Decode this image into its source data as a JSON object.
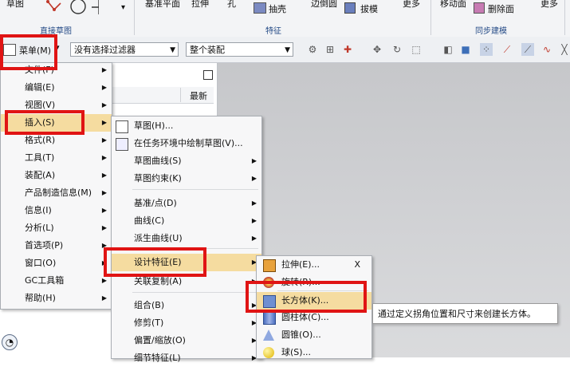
{
  "ribbon": {
    "sketch": "草图",
    "direct_sketch_group": "直接草图",
    "datum_plane": "基准平面",
    "extrude": "拉伸",
    "hole": "孔",
    "shell": "抽壳",
    "edge_blend": "边倒圆",
    "draft": "拔模",
    "more1": "更多",
    "feature_group": "特征",
    "move_face": "移动面",
    "delete_face": "删除面",
    "more2": "更多",
    "sync_group": "同步建模"
  },
  "cmdbar": {
    "menu_label": "菜单(M)",
    "filter": "没有选择过滤器",
    "assembly": "整个装配"
  },
  "panel": {
    "column_latest": "最新"
  },
  "main_menu": [
    {
      "label": "文件(F)",
      "sub": true
    },
    {
      "label": "编辑(E)",
      "sub": true
    },
    {
      "label": "视图(V)",
      "sub": true
    },
    {
      "label": "插入(S)",
      "sub": true
    },
    {
      "label": "格式(R)",
      "sub": true
    },
    {
      "label": "工具(T)",
      "sub": true
    },
    {
      "label": "装配(A)",
      "sub": true
    },
    {
      "label": "产品制造信息(M)",
      "sub": true
    },
    {
      "label": "信息(I)",
      "sub": true
    },
    {
      "label": "分析(L)",
      "sub": true
    },
    {
      "label": "首选项(P)",
      "sub": true
    },
    {
      "label": "窗口(O)",
      "sub": true
    },
    {
      "label": "GC工具箱",
      "sub": true
    },
    {
      "label": "帮助(H)",
      "sub": true
    }
  ],
  "insert_menu": [
    {
      "label": "草图(H)...",
      "icon": "sketch-icon"
    },
    {
      "label": "在任务环境中绘制草图(V)...",
      "icon": "task-sketch-icon"
    },
    {
      "label": "草图曲线(S)",
      "sub": true
    },
    {
      "label": "草图约束(K)",
      "sub": true
    },
    {
      "label": "基准/点(D)",
      "sub": true
    },
    {
      "label": "曲线(C)",
      "sub": true
    },
    {
      "label": "派生曲线(U)",
      "sub": true
    },
    {
      "label": "设计特征(E)",
      "sub": true
    },
    {
      "label": "关联复制(A)",
      "sub": true
    },
    {
      "label": "组合(B)",
      "sub": true
    },
    {
      "label": "修剪(T)",
      "sub": true
    },
    {
      "label": "偏置/缩放(O)",
      "sub": true
    },
    {
      "label": "细节特征(L)",
      "sub": true
    }
  ],
  "design_menu": [
    {
      "label": "拉伸(E)...",
      "icon": "extrude-icon",
      "shortcut": "X"
    },
    {
      "label": "旋转(R)...",
      "icon": "revolve-icon"
    },
    {
      "label": "长方体(K)...",
      "icon": "block-icon"
    },
    {
      "label": "圆柱体(C)...",
      "icon": "cylinder-icon"
    },
    {
      "label": "圆锥(O)...",
      "icon": "cone-icon"
    },
    {
      "label": "球(S)...",
      "icon": "sphere-icon"
    }
  ],
  "tooltip": "通过定义拐角位置和尺寸来创建长方体。",
  "colors": {
    "highlight": "#f5dca0",
    "annotation_red": "#e01414",
    "group_label": "#244a86"
  }
}
